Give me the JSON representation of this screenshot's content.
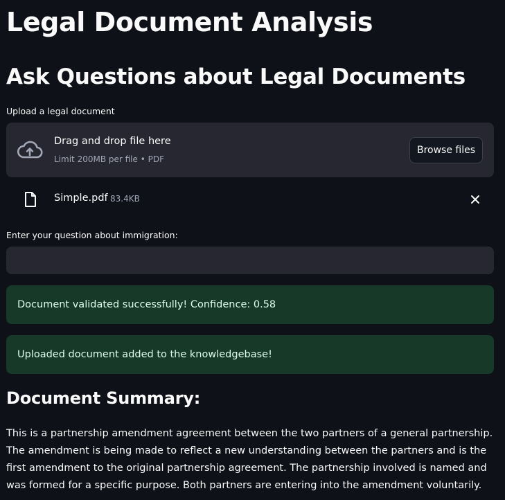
{
  "page": {
    "title": "Legal Document Analysis",
    "subtitle": "Ask Questions about Legal Documents"
  },
  "uploader": {
    "label": "Upload a legal document",
    "drop_text": "Drag and drop file here",
    "limit_text": "Limit 200MB per file • PDF",
    "browse_label": "Browse files",
    "icon": "cloud-upload-icon"
  },
  "uploaded_file": {
    "name": "Simple.pdf",
    "size": "83.4KB",
    "icon": "file-icon",
    "remove_icon": "close-icon"
  },
  "question": {
    "label": "Enter your question about immigration:",
    "value": "",
    "placeholder": ""
  },
  "alerts": [
    {
      "text": "Document validated successfully! Confidence: 0.58",
      "kind": "success"
    },
    {
      "text": "Uploaded document added to the knowledgebase!",
      "kind": "success"
    }
  ],
  "summary": {
    "heading": "Document Summary:",
    "text": "This is a partnership amendment agreement between the two partners of a general partnership. The amendment is being made to reflect a new understanding between the partners and is the first amendment to the original partnership agreement. The partnership involved is named and was formed for a specific purpose. Both partners are entering into the amendment voluntarily."
  },
  "colors": {
    "background": "#0e1117",
    "widget": "#262730",
    "success_bg": "#173928",
    "success_text": "#dffde9"
  }
}
